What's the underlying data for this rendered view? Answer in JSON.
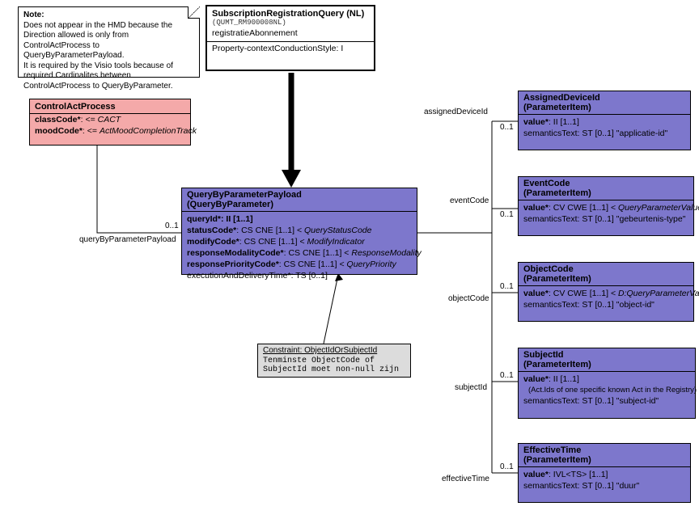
{
  "note": {
    "title": "Note:",
    "body": "Does not appear in the HMD because the Direction allowed is only from ControlActProcess to QueryByParameterPayload.\nIt is required by the Visio tools because of required Cardinalites between ControlActProcess to QueryByParameter."
  },
  "root": {
    "title": "SubscriptionRegistrationQuery (NL)",
    "code": "(QUMT_RM900008NL)",
    "alias": "registratieAbonnement",
    "prop": "Property-contextConductionStyle: I"
  },
  "cap": {
    "title": "ControlActProcess",
    "a1_k": "classCode*",
    "a1_v": ": <= ",
    "a1_vc": "CACT",
    "a2_k": "moodCode*",
    "a2_v": ": <= ",
    "a2_vc": "ActMoodCompletionTrack"
  },
  "qbp": {
    "title": "QueryByParameterPayload",
    "subtitle": "(QueryByParameter)",
    "rows": {
      "r1": "queryId*: II [1..1]",
      "r2_b": "statusCode*",
      "r2_t": ": CS CNE [1..1] < ",
      "r2_i": "QueryStatusCode",
      "r3_b": "modifyCode*",
      "r3_t": ": CS CNE [1..1] < ",
      "r3_i": "ModifyIndicator",
      "r4_b": "responseModalityCode*",
      "r4_t": ": CS CNE [1..1] < ",
      "r4_i": "ResponseModality",
      "r5_b": "responsePriorityCode*",
      "r5_t": ": CS CNE [1..1] < ",
      "r5_i": "QueryPriority",
      "r6": "executionAndDeliveryTime*: TS [0..1]"
    }
  },
  "constraint": {
    "title": "Constraint: ObjectIdOrSubjectId",
    "body": "Tenminste ObjectCode of SubjectId moet non-null zijn"
  },
  "assoc": {
    "qbp_label": "queryByParameterPayload",
    "qbp_mult": "0..1",
    "adi_label": "assignedDeviceId",
    "adi_mult": "0..1",
    "ec_label": "eventCode",
    "ec_mult": "0..1",
    "oc_label": "objectCode",
    "oc_mult": "0..1",
    "si_label": "subjectId",
    "si_mult": "0..1",
    "et_label": "effectiveTime",
    "et_mult": "0..1"
  },
  "params": {
    "ptype": "(ParameterItem)",
    "adi": {
      "name": "AssignedDeviceId",
      "v_b": "value*",
      "v_t": ": II [1..1]",
      "st": "semanticsText: ST [0..1] \"applicatie-id\""
    },
    "ec": {
      "name": "EventCode",
      "v_b": "value*",
      "v_t": ": CV CWE [1..1] < ",
      "v_i": "QueryParameterValue",
      "st": "semanticsText: ST [0..1] \"gebeurtenis-type\""
    },
    "oc": {
      "name": "ObjectCode",
      "v_b": "value*",
      "v_t": ": CV CWE [1..1] < ",
      "v_i": "D:QueryParameterValue",
      "st": "semanticsText: ST [0..1] \"object-id\""
    },
    "si": {
      "name": "SubjectId",
      "v_b": "value*",
      "v_t": ": II [1..1]",
      "extra": "(Act.Ids of one specific known Act in the Registry)",
      "st": "semanticsText: ST [0..1] \"subject-id\""
    },
    "et": {
      "name": "EffectiveTime",
      "v_b": "value*",
      "v_t": ": IVL<TS> [1..1]",
      "st": "semanticsText: ST [0..1] \"duur\""
    }
  }
}
